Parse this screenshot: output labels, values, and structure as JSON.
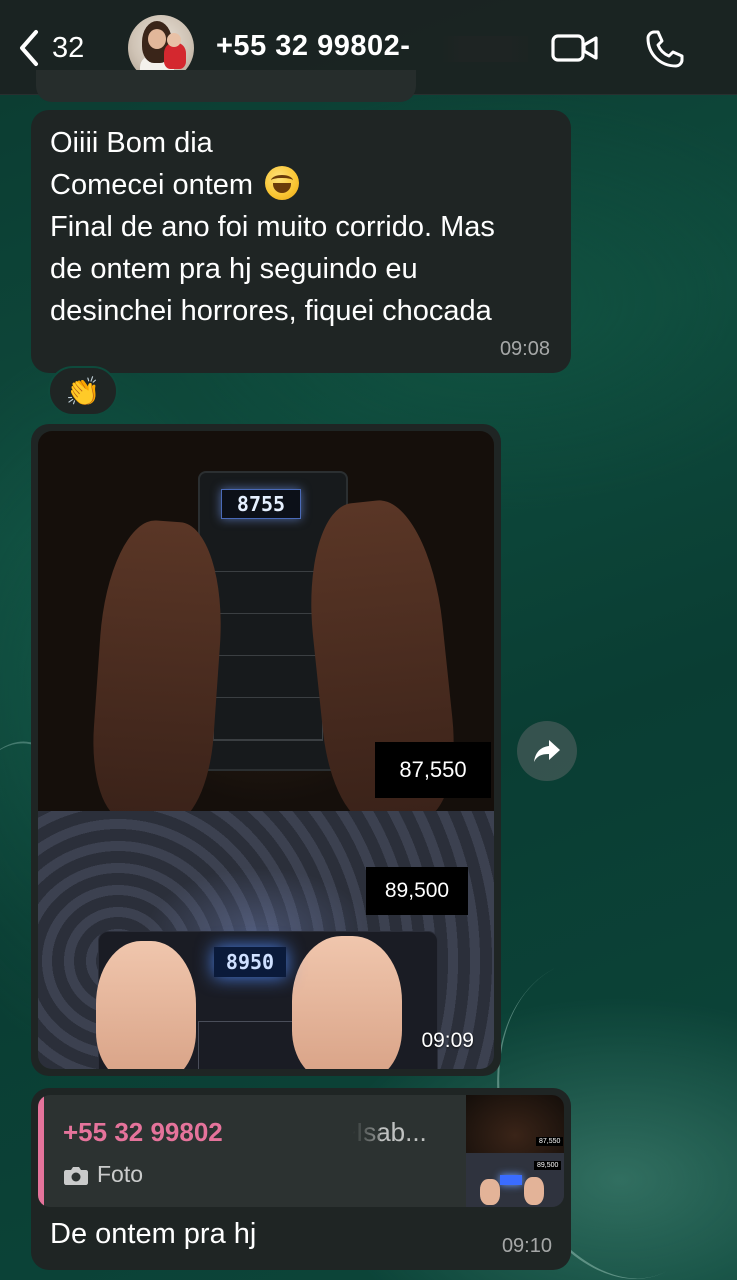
{
  "header": {
    "back_count": "32",
    "contact_name": "+55 32 99802-",
    "icons": {
      "back": "chevron-left-icon",
      "video": "video-call-icon",
      "phone": "phone-call-icon"
    }
  },
  "messages": [
    {
      "type": "text",
      "lines": [
        "Oiiii Bom dia",
        "Comecei ontem",
        "Final de ano foi muito corrido. Mas",
        "de ontem pra hj seguindo eu",
        "desinchei horrores, fiquei chocada"
      ],
      "emoji": "grinning-squinting-face",
      "time": "09:08",
      "reaction": "👏"
    },
    {
      "type": "images",
      "image1": {
        "display": "8755",
        "label": "87,550"
      },
      "image2": {
        "display": "8950",
        "label": "89,500"
      },
      "time": "09:09"
    },
    {
      "type": "reply",
      "quoted_name": "+55 32 99802",
      "quoted_name_suffix": "~Isab...",
      "quoted_kind": "Foto",
      "text": "De ontem pra hj",
      "time": "09:10"
    }
  ],
  "colors": {
    "bubble": "#1f2524",
    "quote_accent": "#e5739b",
    "background": "#0e4a3c"
  }
}
